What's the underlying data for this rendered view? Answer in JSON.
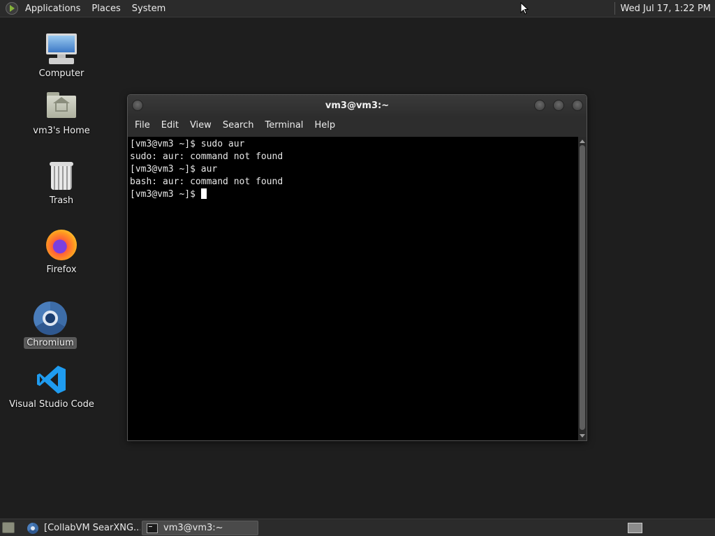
{
  "top_panel": {
    "menus": [
      "Applications",
      "Places",
      "System"
    ],
    "clock": "Wed Jul 17,  1:22 PM"
  },
  "desktop_icons": [
    {
      "label": "Computer",
      "icon": "computer-icon"
    },
    {
      "label": "vm3's Home",
      "icon": "home-folder-icon"
    },
    {
      "label": "Trash",
      "icon": "trash-icon"
    },
    {
      "label": "Firefox",
      "icon": "firefox-icon"
    },
    {
      "label": "Chromium",
      "icon": "chromium-icon",
      "selected": true
    },
    {
      "label": "Visual Studio Code",
      "icon": "vscode-icon"
    }
  ],
  "terminal": {
    "title": "vm3@vm3:~",
    "menus": [
      "File",
      "Edit",
      "View",
      "Search",
      "Terminal",
      "Help"
    ],
    "lines": [
      "[vm3@vm3 ~]$ sudo aur",
      "sudo: aur: command not found",
      "[vm3@vm3 ~]$ aur",
      "bash: aur: command not found"
    ],
    "prompt": "[vm3@vm3 ~]$ "
  },
  "taskbar": {
    "tasks": [
      {
        "label": "[CollabVM SearXNG...",
        "icon": "chromium-icon",
        "active": false
      },
      {
        "label": "vm3@vm3:~",
        "icon": "terminal-icon",
        "active": true
      }
    ]
  },
  "colors": {
    "desktop_bg": "#1e1e1e",
    "panel_bg": "#2b2b2b",
    "terminal_bg": "#000000",
    "terminal_fg": "#e8e8e8"
  }
}
